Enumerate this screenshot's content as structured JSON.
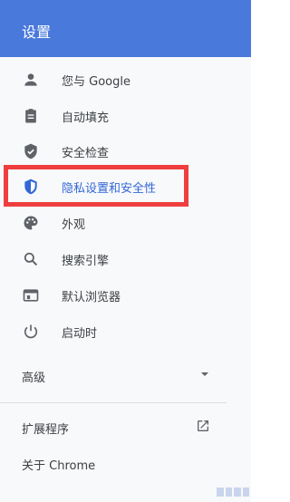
{
  "header": {
    "title": "设置"
  },
  "nav": {
    "items": [
      {
        "label": "您与 Google",
        "icon": "person-icon"
      },
      {
        "label": "自动填充",
        "icon": "clipboard-icon"
      },
      {
        "label": "安全检查",
        "icon": "shield-check-icon"
      },
      {
        "label": "隐私设置和安全性",
        "icon": "shield-half-icon",
        "active": true
      },
      {
        "label": "外观",
        "icon": "palette-icon"
      },
      {
        "label": "搜索引擎",
        "icon": "search-icon"
      },
      {
        "label": "默认浏览器",
        "icon": "browser-window-icon"
      },
      {
        "label": "启动时",
        "icon": "power-icon"
      }
    ]
  },
  "advanced": {
    "label": "高级",
    "icon": "dropdown-arrow-icon"
  },
  "extensions": {
    "label": "扩展程序",
    "icon": "open-in-new-icon"
  },
  "about": {
    "label": "关于 Chrome"
  },
  "colors": {
    "header": "#4a79dc",
    "active": "#3367d6",
    "highlight_border": "#ef3e3e"
  }
}
